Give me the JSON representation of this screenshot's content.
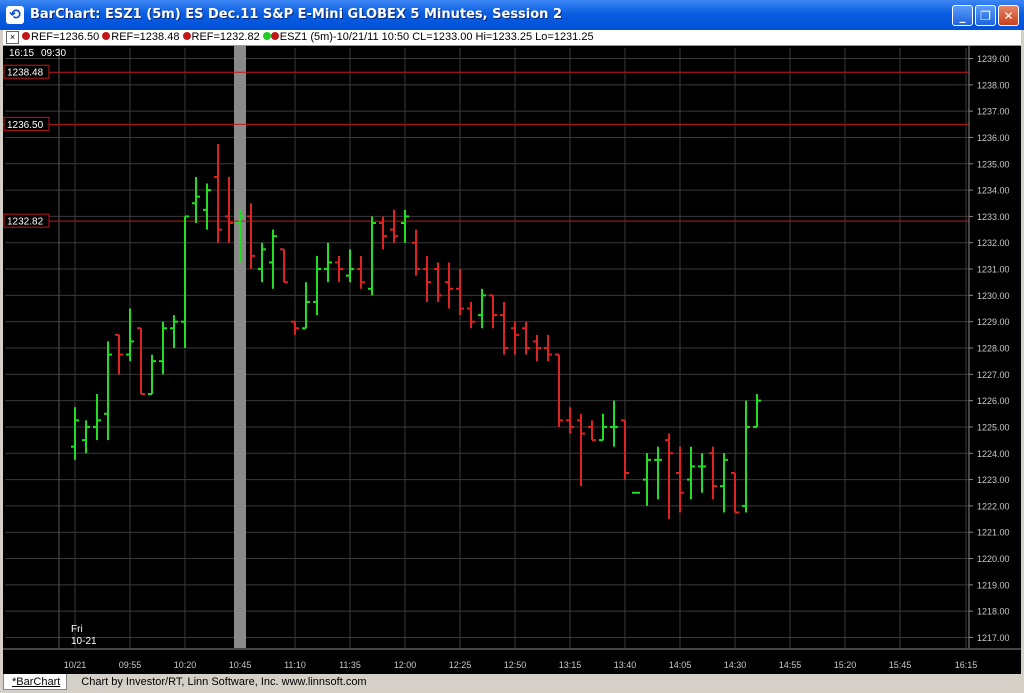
{
  "window": {
    "title": "BarChart: ESZ1 (5m) ES Dec.11 S&P E-Mini GLOBEX 5 Minutes, Session 2",
    "icon": "barchart-app-icon",
    "controls": [
      "minimize-icon",
      "restore-icon",
      "close-icon"
    ]
  },
  "infobar": {
    "close_glyph": "×",
    "refs": [
      "REF=1236.50",
      "REF=1238.48",
      "REF=1232.82"
    ],
    "summary": "ESZ1 (5m)-10/21/11 10:50 CL=1233.00 Hi=1233.25 Lo=1231.25"
  },
  "colors": {
    "up": "#22dd22",
    "down": "#dd2222",
    "ref_line": "#c01818",
    "grid": "#3a3a3a",
    "marker": "#8a8a8a"
  },
  "top_labels": {
    "left": "16:15",
    "right": "09:30"
  },
  "session_label": {
    "day": "Fri",
    "date": "10-21"
  },
  "footer": {
    "tab": "*BarChart",
    "credit": "Chart by Investor/RT, Linn Software, Inc. www.linnsoft.com"
  },
  "chart_data": {
    "type": "ohlc",
    "ylim": [
      1216.6,
      1239.4
    ],
    "y_ticks": [
      "1217.00",
      "1218.00",
      "1219.00",
      "1220.00",
      "1221.00",
      "1222.00",
      "1223.00",
      "1224.00",
      "1225.00",
      "1226.00",
      "1227.00",
      "1228.00",
      "1229.00",
      "1230.00",
      "1231.00",
      "1232.00",
      "1233.00",
      "1234.00",
      "1235.00",
      "1236.00",
      "1237.00",
      "1238.00",
      "1239.00"
    ],
    "y_tick_values": [
      1217,
      1218,
      1219,
      1220,
      1221,
      1222,
      1223,
      1224,
      1225,
      1226,
      1227,
      1228,
      1229,
      1230,
      1231,
      1232,
      1233,
      1234,
      1235,
      1236,
      1237,
      1238,
      1239
    ],
    "x_ticks": [
      "10/21",
      "09:55",
      "10:20",
      "10:45",
      "11:10",
      "11:35",
      "12:00",
      "12:25",
      "12:50",
      "13:15",
      "13:40",
      "14:05",
      "14:30",
      "14:55",
      "15:20",
      "15:45",
      "16:15"
    ],
    "x_tick_index": [
      0,
      5,
      10,
      15,
      20,
      25,
      30,
      35,
      40,
      45,
      50,
      55,
      60,
      65,
      70,
      75,
      81
    ],
    "ref_lines": [
      {
        "label": "1238.48",
        "value": 1238.48
      },
      {
        "label": "1236.50",
        "value": 1236.5
      },
      {
        "label": "1232.82",
        "value": 1232.82
      }
    ],
    "highlight_bar_index": 15,
    "bars": [
      {
        "o": 1224.25,
        "h": 1225.75,
        "l": 1223.75,
        "c": 1225.25
      },
      {
        "o": 1224.5,
        "h": 1225.25,
        "l": 1224.0,
        "c": 1225.0
      },
      {
        "o": 1225.0,
        "h": 1226.25,
        "l": 1224.5,
        "c": 1225.25
      },
      {
        "o": 1225.5,
        "h": 1228.25,
        "l": 1224.5,
        "c": 1227.75
      },
      {
        "o": 1228.5,
        "h": 1228.5,
        "l": 1227.0,
        "c": 1227.75
      },
      {
        "o": 1227.75,
        "h": 1229.5,
        "l": 1227.5,
        "c": 1228.25
      },
      {
        "o": 1228.75,
        "h": 1228.75,
        "l": 1226.25,
        "c": 1226.25
      },
      {
        "o": 1226.25,
        "h": 1227.75,
        "l": 1226.25,
        "c": 1227.5
      },
      {
        "o": 1227.5,
        "h": 1229.0,
        "l": 1227.0,
        "c": 1228.75
      },
      {
        "o": 1228.75,
        "h": 1229.25,
        "l": 1228.0,
        "c": 1229.0
      },
      {
        "o": 1229.0,
        "h": 1233.0,
        "l": 1228.0,
        "c": 1233.0
      },
      {
        "o": 1233.5,
        "h": 1234.5,
        "l": 1232.75,
        "c": 1233.75
      },
      {
        "o": 1233.25,
        "h": 1234.25,
        "l": 1232.5,
        "c": 1234.0
      },
      {
        "o": 1234.5,
        "h": 1235.75,
        "l": 1232.0,
        "c": 1232.5
      },
      {
        "o": 1233.0,
        "h": 1234.5,
        "l": 1232.0,
        "c": 1232.75
      },
      {
        "o": 1232.75,
        "h": 1233.25,
        "l": 1231.25,
        "c": 1233.0
      },
      {
        "o": 1233.0,
        "h": 1233.5,
        "l": 1231.0,
        "c": 1231.5
      },
      {
        "o": 1231.0,
        "h": 1232.0,
        "l": 1230.5,
        "c": 1231.75
      },
      {
        "o": 1231.25,
        "h": 1232.5,
        "l": 1230.25,
        "c": 1232.25
      },
      {
        "o": 1231.75,
        "h": 1231.75,
        "l": 1230.5,
        "c": 1230.5
      },
      {
        "o": 1229.0,
        "h": 1229.0,
        "l": 1228.5,
        "c": 1228.75
      },
      {
        "o": 1228.75,
        "h": 1230.5,
        "l": 1228.75,
        "c": 1229.75
      },
      {
        "o": 1229.75,
        "h": 1231.5,
        "l": 1229.25,
        "c": 1231.0
      },
      {
        "o": 1231.0,
        "h": 1232.0,
        "l": 1230.5,
        "c": 1231.25
      },
      {
        "o": 1231.25,
        "h": 1231.5,
        "l": 1230.5,
        "c": 1231.0
      },
      {
        "o": 1230.75,
        "h": 1231.75,
        "l": 1230.5,
        "c": 1231.0
      },
      {
        "o": 1231.0,
        "h": 1231.5,
        "l": 1230.25,
        "c": 1230.5
      },
      {
        "o": 1230.25,
        "h": 1233.0,
        "l": 1230.0,
        "c": 1232.75
      },
      {
        "o": 1232.75,
        "h": 1233.0,
        "l": 1231.75,
        "c": 1232.25
      },
      {
        "o": 1232.5,
        "h": 1233.25,
        "l": 1232.0,
        "c": 1232.25
      },
      {
        "o": 1232.75,
        "h": 1233.25,
        "l": 1232.0,
        "c": 1233.0
      },
      {
        "o": 1232.0,
        "h": 1232.5,
        "l": 1230.75,
        "c": 1231.0
      },
      {
        "o": 1231.0,
        "h": 1231.5,
        "l": 1229.75,
        "c": 1230.5
      },
      {
        "o": 1231.0,
        "h": 1231.25,
        "l": 1229.75,
        "c": 1230.0
      },
      {
        "o": 1230.5,
        "h": 1231.25,
        "l": 1229.5,
        "c": 1230.25
      },
      {
        "o": 1230.25,
        "h": 1231.0,
        "l": 1229.25,
        "c": 1229.5
      },
      {
        "o": 1229.5,
        "h": 1229.75,
        "l": 1228.75,
        "c": 1229.0
      },
      {
        "o": 1229.25,
        "h": 1230.25,
        "l": 1228.75,
        "c": 1230.0
      },
      {
        "o": 1230.0,
        "h": 1230.0,
        "l": 1228.75,
        "c": 1229.25
      },
      {
        "o": 1229.25,
        "h": 1229.75,
        "l": 1227.75,
        "c": 1228.0
      },
      {
        "o": 1228.75,
        "h": 1229.0,
        "l": 1227.75,
        "c": 1228.5
      },
      {
        "o": 1228.75,
        "h": 1229.0,
        "l": 1227.75,
        "c": 1228.0
      },
      {
        "o": 1228.25,
        "h": 1228.5,
        "l": 1227.5,
        "c": 1228.0
      },
      {
        "o": 1228.0,
        "h": 1228.5,
        "l": 1227.5,
        "c": 1227.75
      },
      {
        "o": 1227.75,
        "h": 1227.75,
        "l": 1225.0,
        "c": 1225.25
      },
      {
        "o": 1225.25,
        "h": 1225.75,
        "l": 1224.75,
        "c": 1225.0
      },
      {
        "o": 1225.25,
        "h": 1225.5,
        "l": 1222.75,
        "c": 1224.75
      },
      {
        "o": 1225.0,
        "h": 1225.25,
        "l": 1224.5,
        "c": 1224.5
      },
      {
        "o": 1224.5,
        "h": 1225.5,
        "l": 1224.5,
        "c": 1225.0
      },
      {
        "o": 1225.0,
        "h": 1226.0,
        "l": 1224.25,
        "c": 1225.0
      },
      {
        "o": 1225.25,
        "h": 1225.25,
        "l": 1223.0,
        "c": 1223.25
      },
      {
        "o": 1222.5,
        "h": 1222.5,
        "l": 1222.5,
        "c": 1222.5
      },
      {
        "o": 1223.0,
        "h": 1224.0,
        "l": 1222.0,
        "c": 1223.75
      },
      {
        "o": 1223.75,
        "h": 1224.25,
        "l": 1222.25,
        "c": 1223.75
      },
      {
        "o": 1224.5,
        "h": 1224.75,
        "l": 1221.5,
        "c": 1224.0
      },
      {
        "o": 1223.25,
        "h": 1224.25,
        "l": 1221.75,
        "c": 1222.5
      },
      {
        "o": 1223.0,
        "h": 1224.25,
        "l": 1222.25,
        "c": 1223.5
      },
      {
        "o": 1223.5,
        "h": 1224.0,
        "l": 1222.5,
        "c": 1223.5
      },
      {
        "o": 1224.0,
        "h": 1224.25,
        "l": 1222.25,
        "c": 1222.75
      },
      {
        "o": 1222.75,
        "h": 1224.0,
        "l": 1221.75,
        "c": 1223.75
      },
      {
        "o": 1223.25,
        "h": 1223.25,
        "l": 1221.75,
        "c": 1221.75
      },
      {
        "o": 1222.0,
        "h": 1226.0,
        "l": 1221.75,
        "c": 1225.0
      },
      {
        "o": 1225.0,
        "h": 1226.25,
        "l": 1225.0,
        "c": 1226.0
      }
    ]
  }
}
